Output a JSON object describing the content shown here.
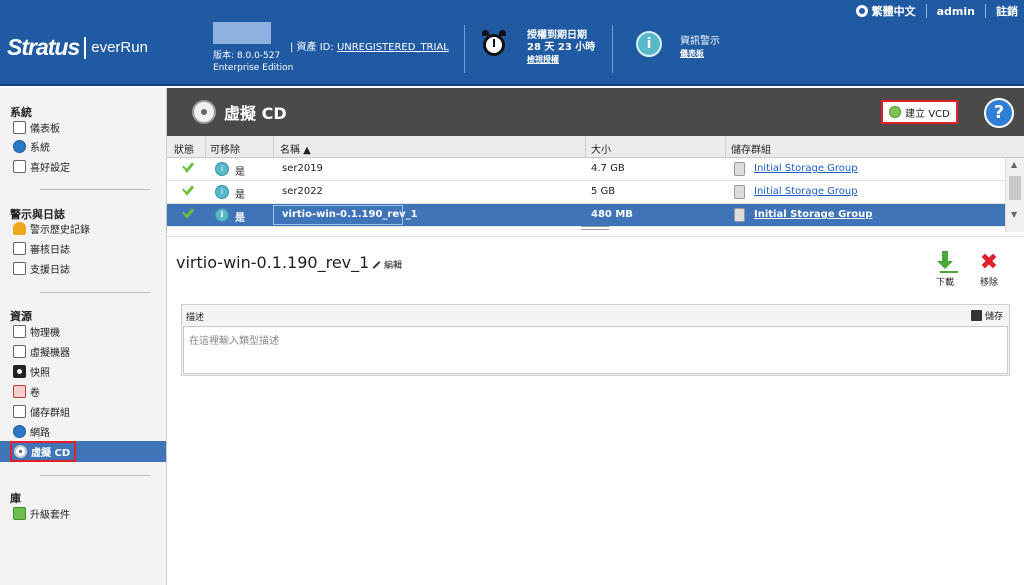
{
  "header": {
    "language": "繁體中文",
    "user": "admin",
    "logout": "註銷",
    "logo_stratus": "Stratus",
    "logo_everrun": "everRun",
    "version": "版本: 8.0.0-527",
    "edition": "Enterprise Edition",
    "asset_label": "| 資產 ID:",
    "asset_id": "UNREGISTERED_TRIAL",
    "license_title": "授權到期日期",
    "license_remaining": "28 天 23 小時",
    "license_link": "檢視授權",
    "alerts_title": "資訊警示",
    "alerts_link": "儀表板"
  },
  "sidebar": {
    "sections": [
      {
        "title": "系統",
        "items": [
          "儀表板",
          "系統",
          "喜好設定"
        ]
      },
      {
        "title": "警示與日誌",
        "items": [
          "警示歷史記錄",
          "審核日誌",
          "支援日誌"
        ]
      },
      {
        "title": "資源",
        "items": [
          "物理機",
          "虛擬機器",
          "快照",
          "卷",
          "儲存群組",
          "網路",
          "虛擬 CD"
        ]
      },
      {
        "title": "庫",
        "items": [
          "升級套件"
        ]
      }
    ],
    "active_item": "虛擬 CD"
  },
  "page": {
    "title": "虛擬 CD",
    "create_vcd_label": "建立 VCD",
    "help_icon": "?"
  },
  "table": {
    "columns": [
      "狀態",
      "可移除",
      "名稱 ▲",
      "大小",
      "儲存群組"
    ],
    "rows": [
      {
        "removable": "是",
        "name": "ser2019",
        "size": "4.7 GB",
        "storage_group": "Initial Storage Group"
      },
      {
        "removable": "是",
        "name": "ser2022",
        "size": "5 GB",
        "storage_group": "Initial Storage Group"
      },
      {
        "removable": "是",
        "name": "virtio-win-0.1.190_rev_1",
        "size": "480 MB",
        "storage_group": "Initial Storage Group"
      }
    ],
    "selected_index": 2
  },
  "details": {
    "title": "virtio-win-0.1.190_rev_1",
    "edit_label": "編輯",
    "download_label": "下載",
    "remove_label": "移除",
    "description_label": "描述",
    "save_label": "儲存",
    "description_placeholder": "在這裡輸入類型描述",
    "description_value": ""
  },
  "colors": {
    "header_blue": "#1f5aa3",
    "selection_blue": "#3f74b8",
    "titlebar_gray": "#4a4a4a",
    "highlight_red": "#e3202a",
    "link_blue": "#1a5ec8"
  }
}
